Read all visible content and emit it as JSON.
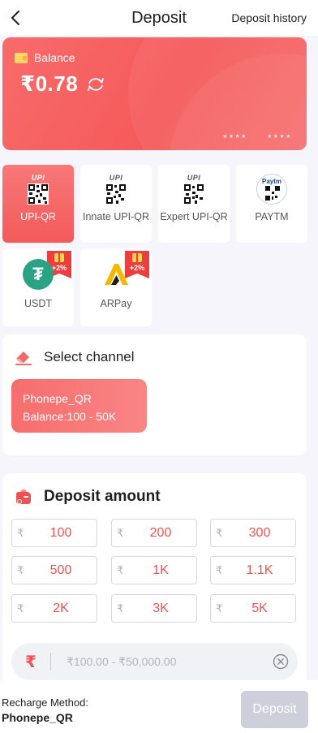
{
  "header": {
    "title": "Deposit",
    "history_label": "Deposit history"
  },
  "balance": {
    "label": "Balance",
    "amount": "₹0.78",
    "card_mask_1": "****",
    "card_mask_2": "****"
  },
  "pay_methods": [
    {
      "name": "UPI-QR",
      "logo": "upi-qr-logo",
      "logo_text": "UPI",
      "active": true
    },
    {
      "name": "Innate UPI-QR",
      "logo": "upi-qr-logo",
      "logo_text": "UPI",
      "active": false
    },
    {
      "name": "Expert UPI-QR",
      "logo": "upi-qr-logo",
      "logo_text": "UPI",
      "active": false
    },
    {
      "name": "PAYTM",
      "logo": "paytm-logo",
      "logo_text": "Paytm",
      "active": false
    },
    {
      "name": "USDT",
      "logo": "usdt-logo",
      "bonus": "+2%",
      "active": false
    },
    {
      "name": "ARPay",
      "logo": "arpay-logo",
      "bonus": "+2%",
      "active": false
    }
  ],
  "channel": {
    "title": "Select channel",
    "selected": {
      "name": "Phonepe_QR",
      "balance": "Balance:100 - 50K"
    }
  },
  "amount": {
    "title": "Deposit amount",
    "currency_symbol": "₹",
    "presets": [
      "100",
      "200",
      "300",
      "500",
      "1K",
      "1.1K",
      "2K",
      "3K",
      "5K"
    ],
    "input_placeholder": "₹100.00 - ₹50,000.00",
    "input_value": ""
  },
  "footer": {
    "method_label": "Recharge Method:",
    "method_value": "Phonepe_QR",
    "deposit_label": "Deposit"
  },
  "colors": {
    "accent": "#f55a5a",
    "amount_text": "#f0524f",
    "disabled_button": "#cdd0db"
  }
}
